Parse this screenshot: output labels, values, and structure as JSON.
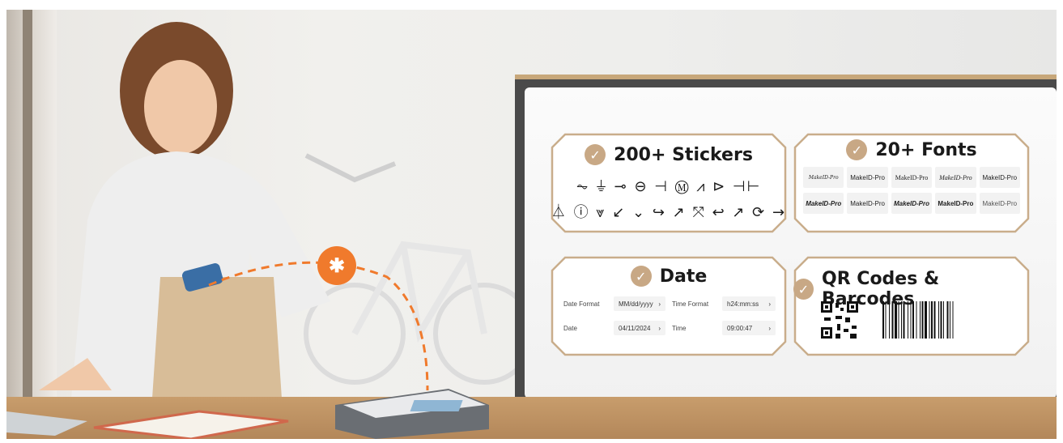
{
  "cards": {
    "stickers": {
      "title": "200+ Stickers",
      "row1": "⏦ ⏚ ⊸ ⊖ ⊣ Ⓜ ⩘ ⊳ ⊣⊢",
      "row2": "⏃ ⓘ ⩔ ↙ ⌄ ↪ ↗ ⤧ ↩ ↗ ⟳ →"
    },
    "fonts": {
      "title": "20+ Fonts",
      "samples": [
        "MakeID-Pro",
        "MakeID-Pro",
        "MakeID-Pro",
        "MakeID-Pro",
        "MakeID-Pro",
        "MakeID-Pro",
        "MakeID-Pro",
        "MakeID-Pro",
        "MakeID-Pro",
        "MakeID-Pro"
      ]
    },
    "date": {
      "title": "Date",
      "date_format_label": "Date Format",
      "date_format_value": "MM/dd/yyyy",
      "time_format_label": "Time Format",
      "time_format_value": "h24:mm:ss",
      "date_label": "Date",
      "date_value": "04/11/2024",
      "time_label": "Time",
      "time_value": "09:00:47",
      "chevron": "›"
    },
    "codes": {
      "title": "QR Codes & Barcodes"
    }
  },
  "icons": {
    "check": "check-circle-icon",
    "bluetooth": "bluetooth-icon"
  },
  "colors": {
    "accent": "#c8a885",
    "bluetooth": "#f07a2c",
    "card_border": "#c9ad8b"
  }
}
